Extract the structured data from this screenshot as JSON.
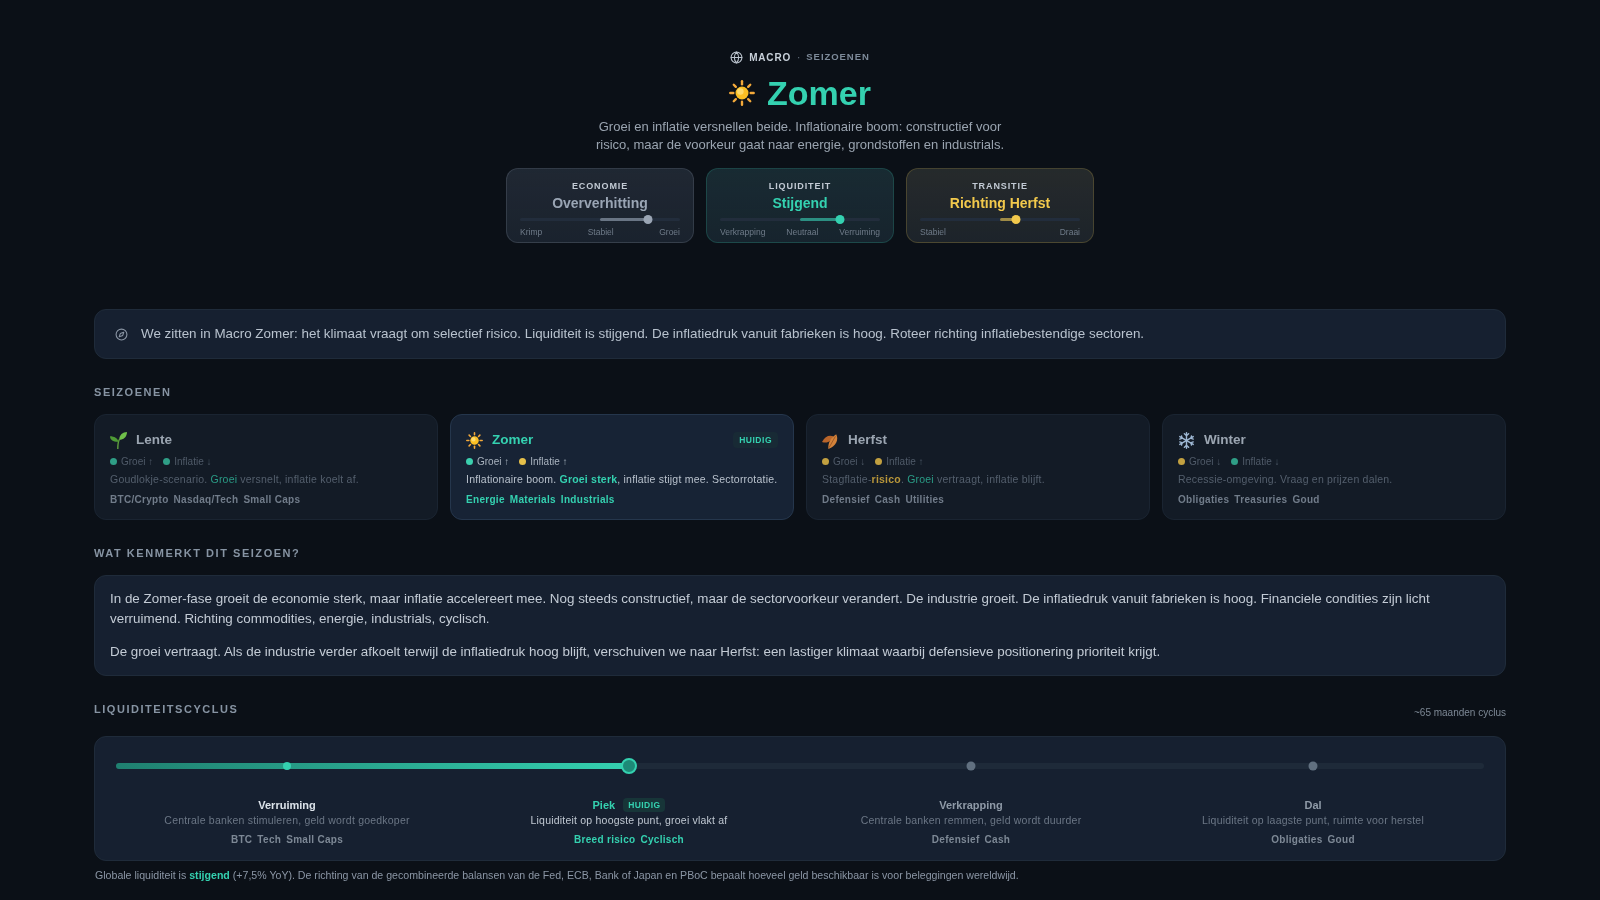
{
  "breadcrumb": {
    "section": "MACRO",
    "separator": "·",
    "page": "SEIZOENEN"
  },
  "header": {
    "kind": "summer",
    "title": "Zomer",
    "description": "Groei en inflatie versnellen beide. Inflationaire boom: constructief voor risico, maar de voorkeur gaat naar energie, grondstoffen en industrials."
  },
  "meters": [
    {
      "label": "ECONOMIE",
      "value": "Oververhitting",
      "color": "#9aa5b4",
      "level": 0.8,
      "ticks": [
        "Krimp",
        "Stabiel",
        "Groei"
      ]
    },
    {
      "label": "LIQUIDITEIT",
      "value": "Stijgend",
      "color": "#34d1b0",
      "level": 0.75,
      "ticks": [
        "Verkrapping",
        "Neutraal",
        "Verruiming"
      ]
    },
    {
      "label": "TRANSITIE",
      "value": "Richting Herfst",
      "color": "#f2c94c",
      "level": 0.6,
      "ticks": [
        "Stabiel",
        "Draai"
      ]
    }
  ],
  "insight": "We zitten in Macro Zomer: het klimaat vraagt om selectief risico. Liquiditeit is stijgend. De inflatiedruk vanuit fabrieken is hoog. Roteer richting inflatiebestendige sectoren.",
  "seasons": {
    "title": "SEIZOENEN",
    "items": [
      {
        "kind": "spring",
        "name": "Lente",
        "selected": false,
        "signals": [
          {
            "label": "Groei ↑",
            "color": "#2f9e86"
          },
          {
            "label": "Inflatie ↓",
            "color": "#2f9e86"
          }
        ],
        "description": [
          {
            "text": "Goudlokje-scenario. ",
            "kind": "plain"
          },
          {
            "text": "Groei",
            "kind": "positive"
          },
          {
            "text": " versnelt, inflatie koelt af.",
            "kind": "plain"
          }
        ],
        "assets": [
          "BTC/Crypto",
          "Nasdaq/Tech",
          "Small Caps"
        ]
      },
      {
        "kind": "summer",
        "name": "Zomer",
        "selected": true,
        "badge": "HUIDIG",
        "signals": [
          {
            "label": "Groei ↑",
            "color": "#3ccfae"
          },
          {
            "label": "Inflatie ↑",
            "color": "#e6c04a"
          }
        ],
        "description": [
          {
            "text": "Inflationaire boom. ",
            "kind": "plain"
          },
          {
            "text": "Groei sterk",
            "kind": "positive"
          },
          {
            "text": ", inflatie stijgt mee. Sectorrotatie.",
            "kind": "plain"
          }
        ],
        "assets": [
          "Energie",
          "Materials",
          "Industrials"
        ]
      },
      {
        "kind": "autumn",
        "name": "Herfst",
        "selected": false,
        "signals": [
          {
            "label": "Groei ↓",
            "color": "#c2a040"
          },
          {
            "label": "Inflatie ↑",
            "color": "#c2a040"
          }
        ],
        "description": [
          {
            "text": "Stagflatie-",
            "kind": "plain"
          },
          {
            "text": "risico",
            "kind": "warning"
          },
          {
            "text": ". ",
            "kind": "plain"
          },
          {
            "text": "Groei",
            "kind": "positive"
          },
          {
            "text": " vertraagt, inflatie blijft.",
            "kind": "plain"
          }
        ],
        "assets": [
          "Defensief",
          "Cash",
          "Utilities"
        ]
      },
      {
        "kind": "winter",
        "name": "Winter",
        "selected": false,
        "signals": [
          {
            "label": "Groei ↓",
            "color": "#c2a040"
          },
          {
            "label": "Inflatie ↓",
            "color": "#2f9e86"
          }
        ],
        "description": [
          {
            "text": "Recessie-omgeving. Vraag en prijzen dalen.",
            "kind": "plain"
          }
        ],
        "assets": [
          "Obligaties",
          "Treasuries",
          "Goud"
        ]
      }
    ]
  },
  "characteristics": {
    "title": "WAT KENMERKT DIT SEIZOEN?",
    "paragraphs": [
      "In de Zomer-fase groeit de economie sterk, maar inflatie accelereert mee. Nog steeds constructief, maar de sectorvoorkeur verandert. De industrie groeit. De inflatiedruk vanuit fabrieken is hoog. Financiele condities zijn licht verruimend. Richting commodities, energie, industrials, cyclisch.",
      "De groei vertraagt. Als de industrie verder afkoelt terwijl de inflatiedruk hoog blijft, verschuiven we naar Herfst: een lastiger klimaat waarbij defensieve positionering prioriteit krijgt."
    ]
  },
  "cycle": {
    "title": "LIQUIDITEITSCYCLUS",
    "note": "~65 maanden cyclus",
    "level": 0.375,
    "phases": [
      {
        "name": "Verruiming",
        "description": "Centrale banken stimuleren, geld wordt goedkoper",
        "assets": [
          "BTC",
          "Tech",
          "Small Caps"
        ],
        "passed": true,
        "selected": false
      },
      {
        "name": "Piek",
        "badge": "HUIDIG",
        "description": "Liquiditeit op hoogste punt, groei vlakt af",
        "assets": [
          "Breed risico",
          "Cyclisch"
        ],
        "passed": false,
        "selected": true
      },
      {
        "name": "Verkrapping",
        "description": "Centrale banken remmen, geld wordt duurder",
        "assets": [
          "Defensief",
          "Cash"
        ],
        "passed": false,
        "selected": false
      },
      {
        "name": "Dal",
        "description": "Liquiditeit op laagste punt, ruimte voor herstel",
        "assets": [
          "Obligaties",
          "Goud"
        ],
        "passed": false,
        "selected": false
      }
    ],
    "footer": "Globale liquiditeit is **stijgend** (+7,5% YoY). De richting van de gecombineerde balansen van de Fed, ECB, Bank of Japan en PBoC bepaalt hoeveel geld beschikbaar is voor beleggingen wereldwijd."
  }
}
